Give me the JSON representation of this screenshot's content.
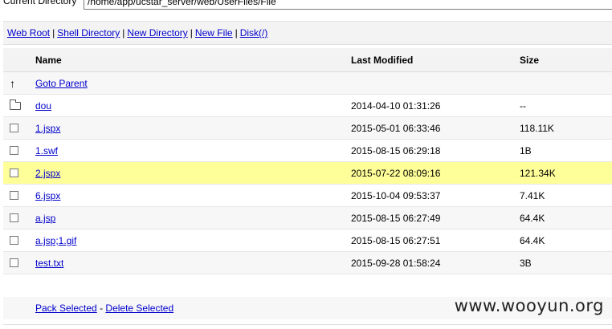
{
  "directory": {
    "label": "Current Directory",
    "path": "/home/app/ucstar_server/web/UserFiles/File"
  },
  "nav": {
    "web_root": "Web Root",
    "shell_directory": "Shell Directory",
    "new_directory": "New Directory",
    "new_file": "New File",
    "disk": "Disk(/)",
    "separator": "|"
  },
  "table": {
    "headers": {
      "name": "Name",
      "last_modified": "Last Modified",
      "size": "Size"
    },
    "goto_parent": "Goto Parent",
    "rows": [
      {
        "name": "dou",
        "modified": "2014-04-10 01:31:26",
        "size": "--",
        "type": "folder"
      },
      {
        "name": "1.jspx",
        "modified": "2015-05-01 06:33:46",
        "size": "118.11K",
        "type": "file"
      },
      {
        "name": "1.swf",
        "modified": "2015-08-15 06:29:18",
        "size": "1B",
        "type": "file"
      },
      {
        "name": "2.jspx",
        "modified": "2015-07-22 08:09:16",
        "size": "121.34K",
        "type": "file",
        "highlighted": true
      },
      {
        "name": "6.jspx",
        "modified": "2015-10-04 09:53:37",
        "size": "7.41K",
        "type": "file"
      },
      {
        "name": "a.jsp",
        "modified": "2015-08-15 06:27:49",
        "size": "64.4K",
        "type": "file"
      },
      {
        "name": "a.jsp;1.gif",
        "modified": "2015-08-15 06:27:51",
        "size": "64.4K",
        "type": "file"
      },
      {
        "name": "test.txt",
        "modified": "2015-09-28 01:58:24",
        "size": "3B",
        "type": "file"
      }
    ]
  },
  "footer": {
    "pack_selected": "Pack Selected",
    "separator": "-",
    "delete_selected": "Delete Selected"
  },
  "watermark": "www.wooyun.org",
  "colors": {
    "link": "#0000cc",
    "highlight": "#ffff99",
    "row_alt": "#f7f7f7"
  }
}
